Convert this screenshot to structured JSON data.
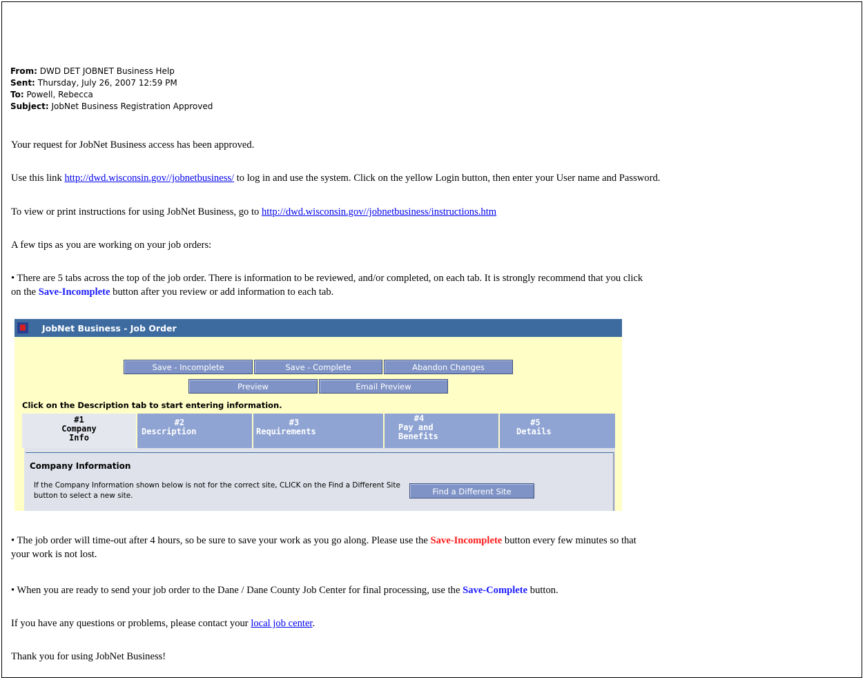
{
  "header": {
    "from_label": "From:",
    "from_value": "DWD DET JOBNET Business Help",
    "sent_label": "Sent:",
    "sent_value": "Thursday, July 26, 2007 12:59 PM",
    "to_label": "To:",
    "to_value": "Powell, Rebecca",
    "subject_label": "Subject:",
    "subject_value": "JobNet Business Registration Approved"
  },
  "body": {
    "p1": "Your request for JobNet Business access has been approved.",
    "p2_pre": "Use this link ",
    "p2_link": "http://dwd.wisconsin.gov//jobnetbusiness/",
    "p2_post": " to log in and use the system. Click on the yellow Login button, then enter your User name and Password.",
    "p3_pre": "To view or print instructions for using JobNet Business, go to ",
    "p3_link": "http://dwd.wisconsin.gov//jobnetbusiness/instructions.htm",
    "p4": "A few tips as you are working on your job orders:",
    "b1_line1": "• There are 5 tabs across the top of the job order. There is information to be reviewed, and/or completed, on each tab. It is strongly recommend that you click",
    "b1_line2_pre": "on the ",
    "b1_line2_bold": "Save-Incomplete",
    "b1_line2_post": " button after you review or add information to each tab.",
    "b2_line1_pre": "• The job order will time-out after 4 hours, so be sure to save your work as you go along. Please use the ",
    "b2_line1_bold": "Save-Incomplete",
    "b2_line1_post": " button every few minutes so that",
    "b2_line2": "your work is not lost.",
    "b3_pre": "• When you are ready to send your job order to the Dane / Dane County Job Center for final processing, use the ",
    "b3_bold": "Save-Complete",
    "b3_post": " button.",
    "p5_pre": "If you have any questions or problems, please contact your ",
    "p5_link": "local job center",
    "p5_post": ".",
    "p6": "Thank you for using JobNet Business!"
  },
  "screenshot": {
    "title": "JobNet Business - Job Order",
    "buttons": {
      "save_incomplete": "Save - Incomplete",
      "save_complete": "Save - Complete",
      "abandon": "Abandon Changes",
      "preview": "Preview",
      "email_preview": "Email Preview",
      "find_site": "Find a Different Site"
    },
    "instruction": "Click on the Description tab to start entering information.",
    "tabs": [
      {
        "num": "#1",
        "l1": "Company",
        "l2": "Info"
      },
      {
        "num": "#2",
        "l1": "Description",
        "l2": ""
      },
      {
        "num": "#3",
        "l1": "Requirements",
        "l2": ""
      },
      {
        "num": "#4",
        "l1": "Pay and",
        "l2": "Benefits"
      },
      {
        "num": "#5",
        "l1": "Details",
        "l2": ""
      }
    ],
    "panel_title": "Company Information",
    "panel_text": "If the Company Information shown below is not for the correct site, CLICK on the Find a Different Site button to select a new site."
  },
  "colors": {
    "link": "#0000ee",
    "highlight_blue": "#1a1aff",
    "highlight_red": "#ff1a1a",
    "shot_titlebar": "#3d6ba0",
    "shot_bg": "#fffec6",
    "shot_button": "#7f93c6",
    "shot_tab": "#8fa4d3"
  }
}
